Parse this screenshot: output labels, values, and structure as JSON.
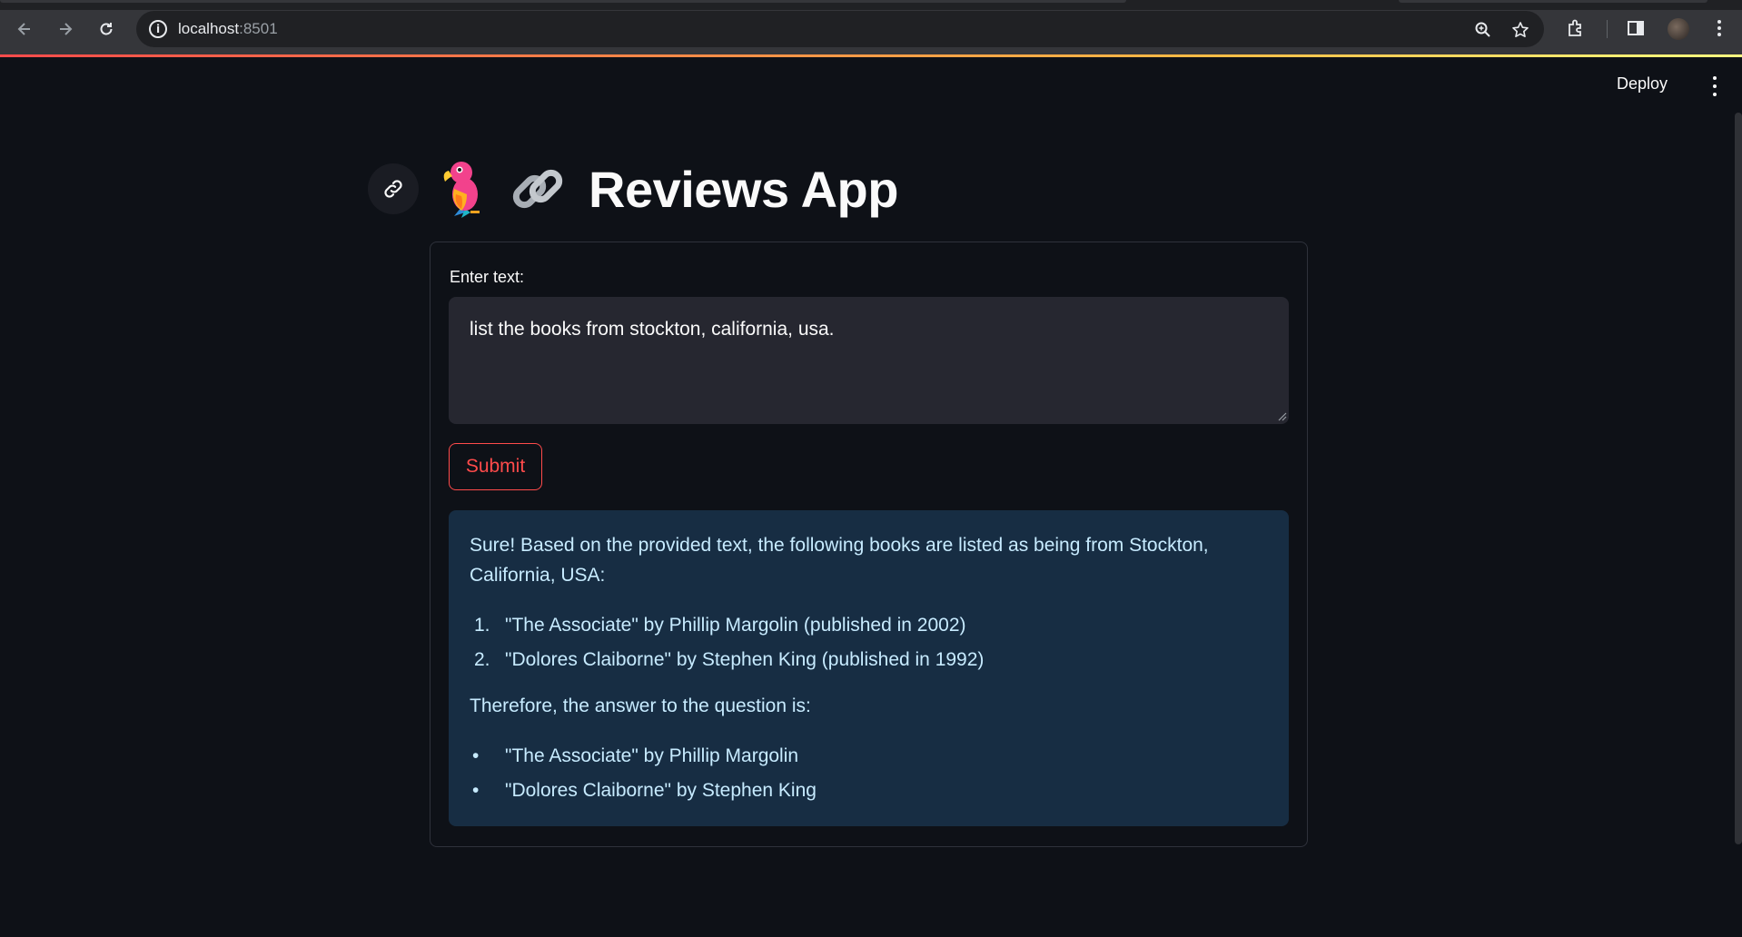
{
  "browser": {
    "url_host": "localhost",
    "url_port": ":8501"
  },
  "header": {
    "deploy_label": "Deploy"
  },
  "title": {
    "text": "Reviews App",
    "emoji_left": "parrot-icon",
    "emoji_right": "chain-link-icon"
  },
  "form": {
    "input_label": "Enter text:",
    "input_value": "list the books from stockton, california, usa.",
    "submit_label": "Submit"
  },
  "response": {
    "intro": "Sure! Based on the provided text, the following books are listed as being from Stockton, California, USA:",
    "numbered": [
      {
        "marker": "1.",
        "text": "\"The Associate\" by Phillip Margolin (published in 2002)"
      },
      {
        "marker": "2.",
        "text": "\"Dolores Claiborne\" by Stephen King (published in 1992)"
      }
    ],
    "mid": "Therefore, the answer to the question is:",
    "bullets": [
      {
        "marker": "•",
        "text": "\"The Associate\" by Phillip Margolin"
      },
      {
        "marker": "•",
        "text": "\"Dolores Claiborne\" by Stephen King"
      }
    ]
  },
  "colors": {
    "background": "#0e1117",
    "accent": "#ff4b4b",
    "response_bg": "#172d43",
    "response_text": "#c7ebff",
    "input_bg": "#262730"
  }
}
